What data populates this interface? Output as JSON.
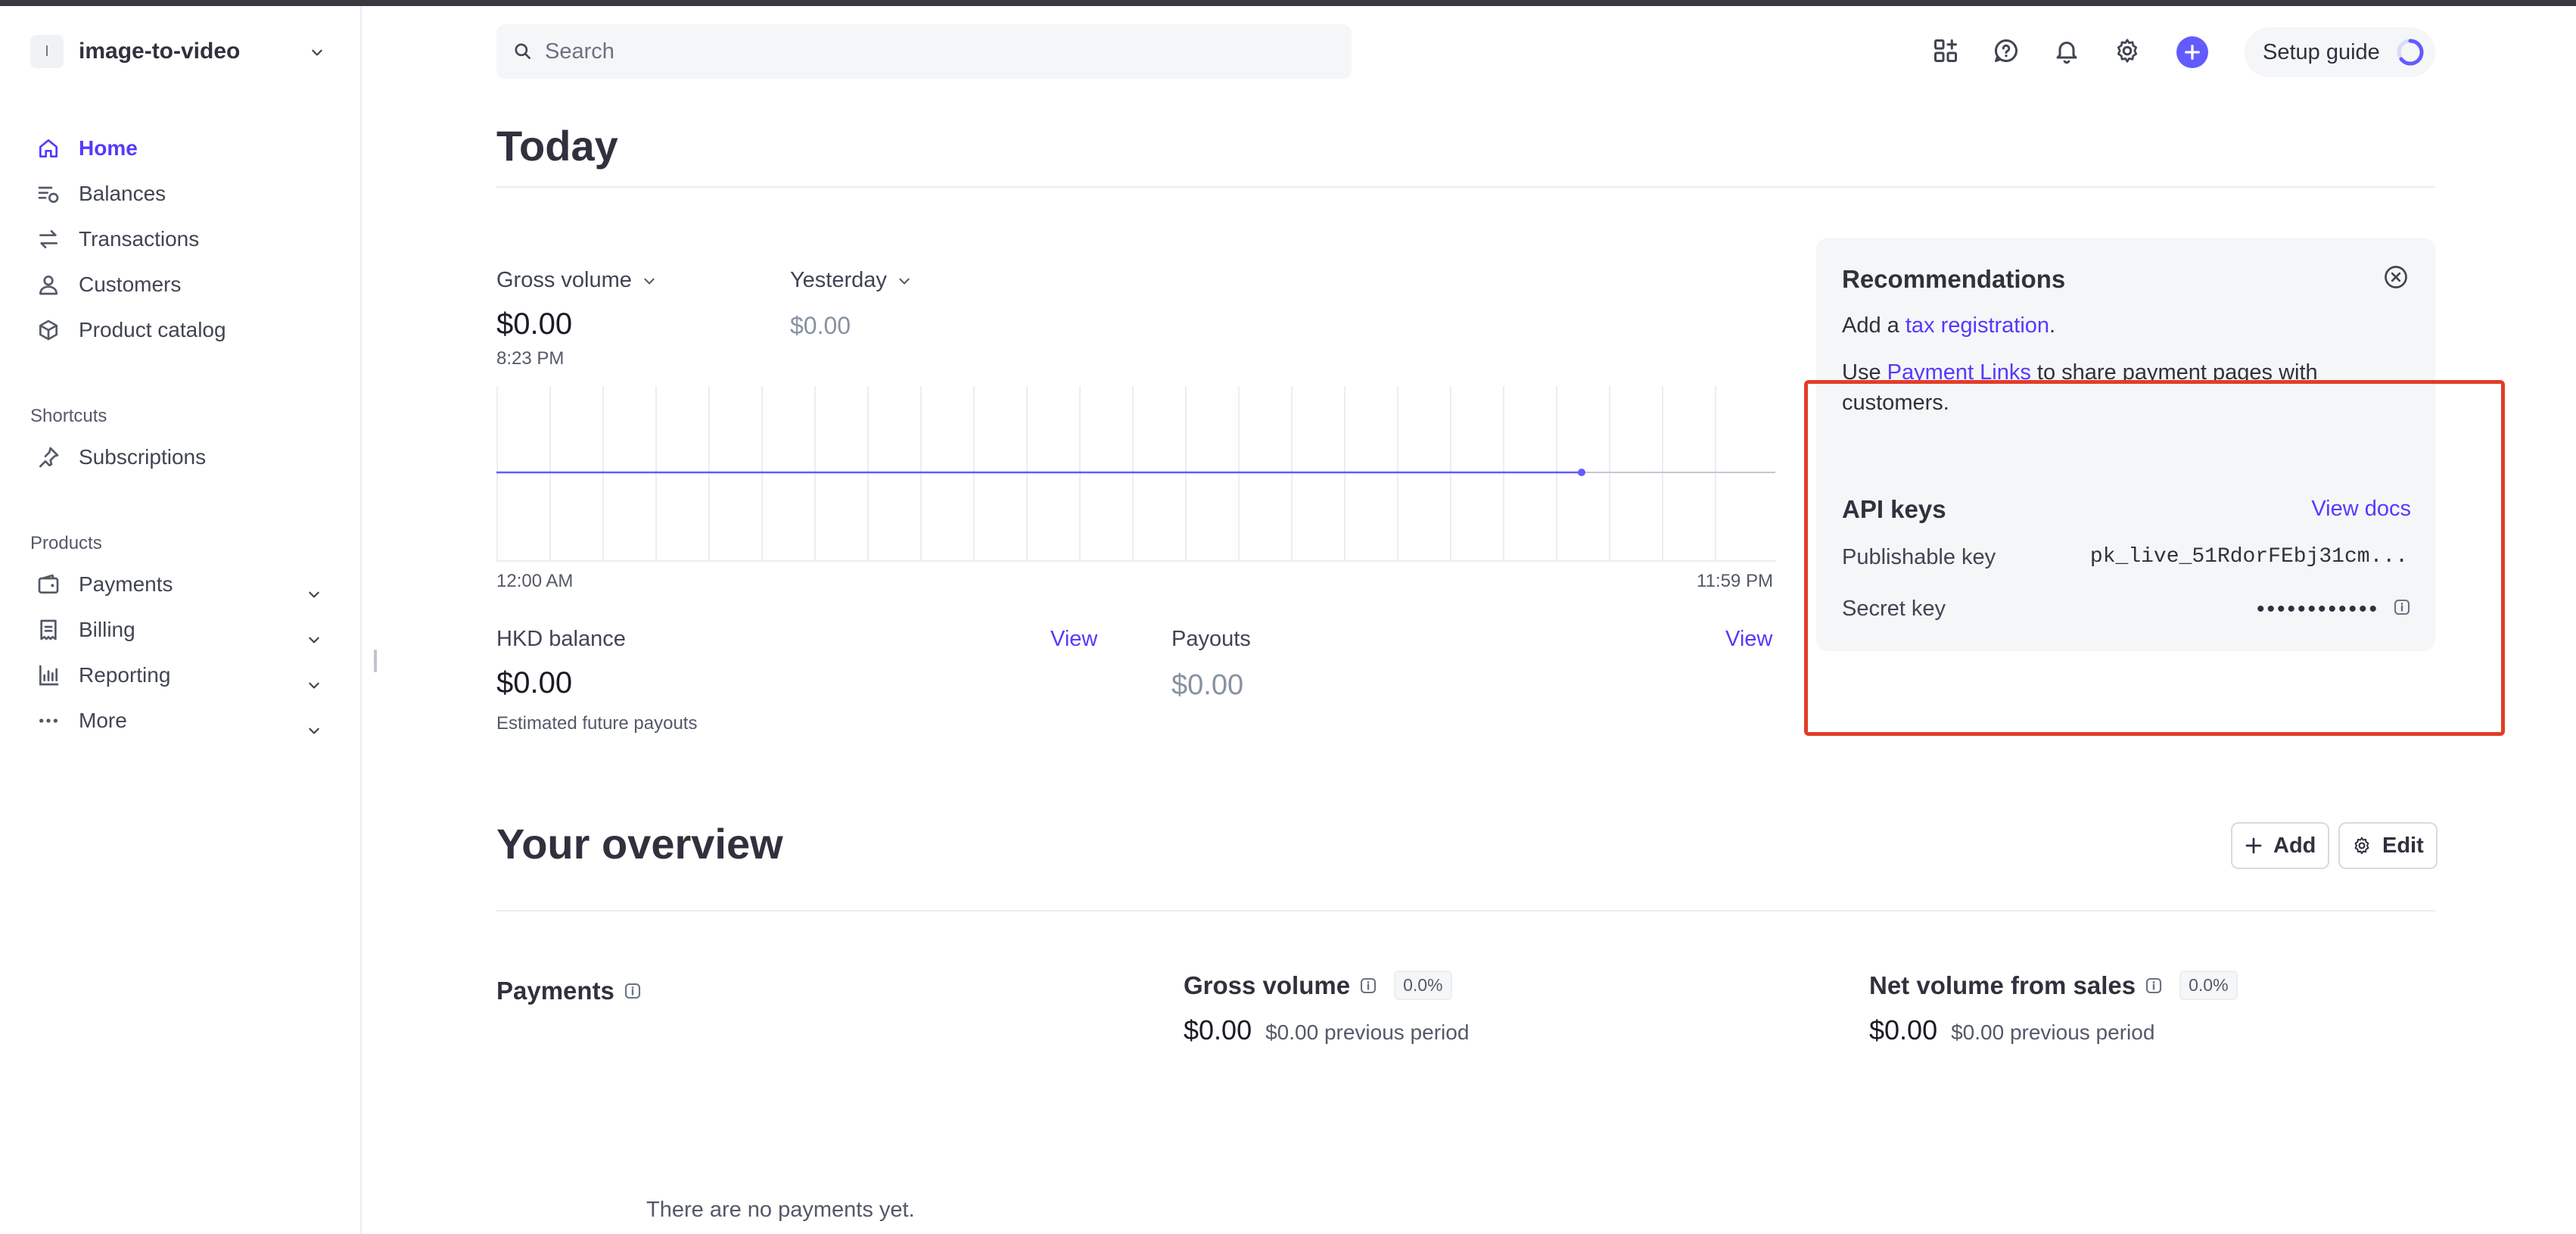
{
  "account": {
    "initial": "I",
    "name": "image-to-video"
  },
  "sidebar": {
    "items": [
      {
        "label": "Home",
        "icon": "home-icon"
      },
      {
        "label": "Balances",
        "icon": "balances-icon"
      },
      {
        "label": "Transactions",
        "icon": "transactions-icon"
      },
      {
        "label": "Customers",
        "icon": "customers-icon"
      },
      {
        "label": "Product catalog",
        "icon": "product-catalog-icon"
      }
    ],
    "shortcuts_label": "Shortcuts",
    "shortcuts": [
      {
        "label": "Subscriptions",
        "icon": "pin-icon"
      }
    ],
    "products_label": "Products",
    "products": [
      {
        "label": "Payments",
        "icon": "payments-icon"
      },
      {
        "label": "Billing",
        "icon": "billing-icon"
      },
      {
        "label": "Reporting",
        "icon": "reporting-icon"
      },
      {
        "label": "More",
        "icon": "more-icon"
      }
    ]
  },
  "header": {
    "search_placeholder": "Search",
    "setup_guide": "Setup guide"
  },
  "today": {
    "title": "Today",
    "gross_volume": {
      "label": "Gross volume",
      "value": "$0.00",
      "time": "8:23 PM"
    },
    "yesterday": {
      "label": "Yesterday",
      "value": "$0.00"
    },
    "chart_start": "12:00 AM",
    "chart_end": "11:59 PM",
    "hkd_balance": {
      "label": "HKD balance",
      "link": "View",
      "value": "$0.00",
      "note": "Estimated future payouts"
    },
    "payouts": {
      "label": "Payouts",
      "link": "View",
      "value": "$0.00"
    }
  },
  "recommendations": {
    "title": "Recommendations",
    "line1_prefix": "Add a ",
    "line1_link": "tax registration",
    "line1_suffix": ".",
    "line2_prefix": "Use ",
    "line2_link": "Payment Links",
    "line2_suffix": " to share payment pages with customers."
  },
  "api_keys": {
    "title": "API keys",
    "docs_link": "View docs",
    "publishable_label": "Publishable key",
    "publishable_value": "pk_live_51RdorFEbj31cm...",
    "secret_label": "Secret key",
    "secret_value": "••••••••••••"
  },
  "overview": {
    "title": "Your overview",
    "add_label": "Add",
    "edit_label": "Edit",
    "payments_title": "Payments",
    "gross_volume": {
      "title": "Gross volume",
      "pct": "0.0%",
      "value": "$0.00",
      "prev": "$0.00 previous period"
    },
    "net_volume": {
      "title": "Net volume from sales",
      "pct": "0.0%",
      "value": "$0.00",
      "prev": "$0.00 previous period"
    },
    "empty_text": "There are no payments yet."
  },
  "colors": {
    "accent": "#533afd",
    "highlight_box": "#e23d28"
  }
}
